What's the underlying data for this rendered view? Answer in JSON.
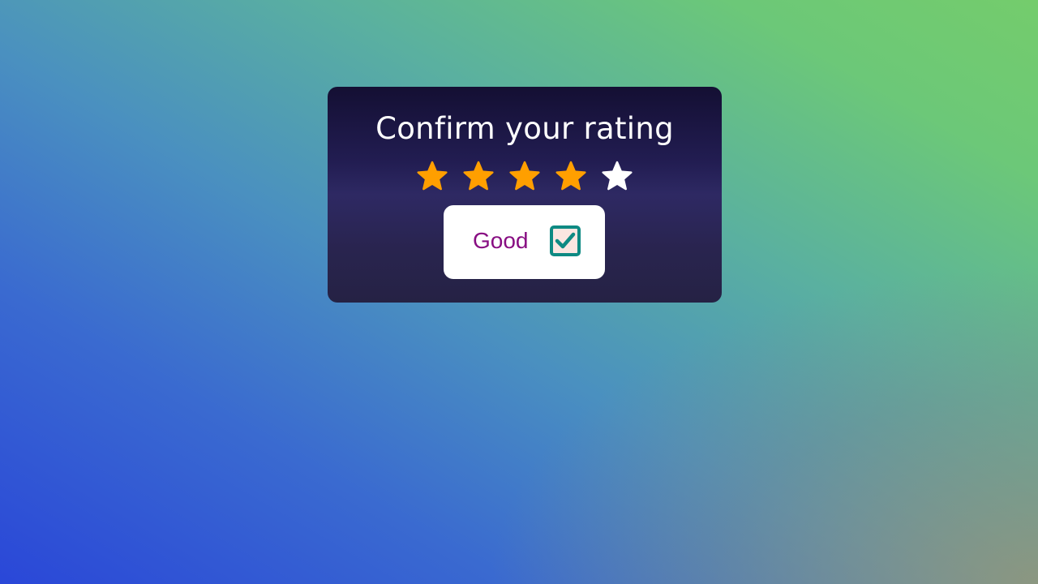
{
  "dialog": {
    "title": "Confirm your rating",
    "rating": {
      "value": 4,
      "max": 5
    },
    "stars": [
      {
        "icon": "star-filled-icon",
        "filled": true
      },
      {
        "icon": "star-filled-icon",
        "filled": true
      },
      {
        "icon": "star-filled-icon",
        "filled": true
      },
      {
        "icon": "star-filled-icon",
        "filled": true
      },
      {
        "icon": "star-empty-icon",
        "filled": false
      }
    ],
    "confirm_button": {
      "label": "Good",
      "icon": "checkbox-checked-icon"
    }
  },
  "colors": {
    "star_filled": "#ff9f00",
    "star_empty": "#ffffff",
    "button_text": "#880e82",
    "check_accent": "#0e8a83",
    "check_fill": "#fae6e1",
    "card_top": "#140f33",
    "card_mid": "#2e2963"
  }
}
